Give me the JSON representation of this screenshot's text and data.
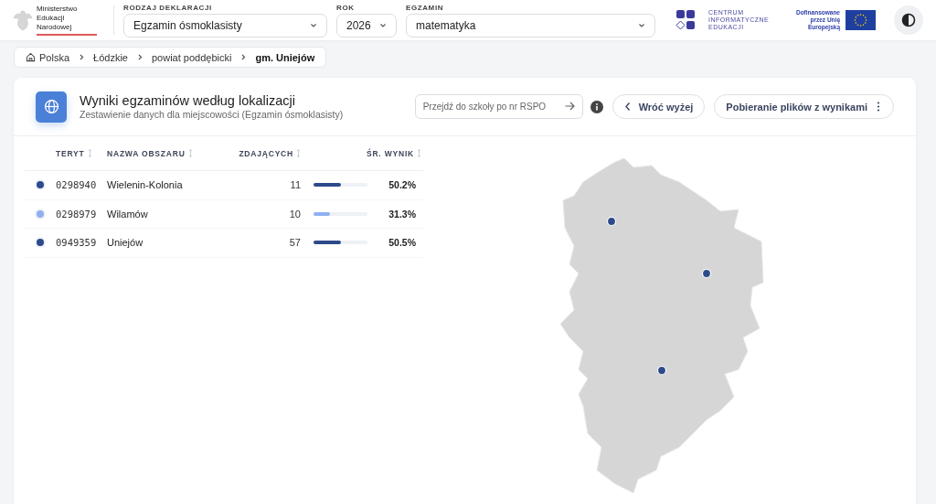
{
  "header": {
    "ministry_logo": "Ministerstwo Edukacji Narodowej",
    "filters": [
      {
        "label": "RODZAJ DEKLARACJI",
        "value": "Egzamin ósmoklasisty"
      },
      {
        "label": "ROK",
        "value": "2026"
      },
      {
        "label": "EGZAMIN",
        "value": "matematyka"
      }
    ],
    "cie_logo": "CENTRUM INFORMATYCZNE EDUKACJI",
    "eu_logo": "Dofinansowane przez Unię Europejską"
  },
  "breadcrumb": [
    {
      "label": "Polska",
      "current": false
    },
    {
      "label": "Łódzkie",
      "current": false
    },
    {
      "label": "powiat poddębicki",
      "current": false
    },
    {
      "label": "gm. Uniejów",
      "current": true
    }
  ],
  "card": {
    "title": "Wyniki egzaminów według lokalizacji",
    "subtitle": "Zestawienie danych dla miejscowości (Egzamin ósmoklasisty)",
    "rspo": {
      "placeholder": "Przejdź do szkoły po nr RSPO"
    },
    "buttons": [
      "Wróć wyżej",
      "Pobieranie plików z wynikami"
    ]
  },
  "table": {
    "columns": [
      "TERYT",
      "NAZWA OBSZARU",
      "ZDAJĄCYCH",
      "ŚR. WYNIK"
    ],
    "rows": [
      {
        "color": "#2d4a8a",
        "teryt": "0298940",
        "name": "Wielenin-Kolonia",
        "count": "11",
        "level": 0.502,
        "result": "50.2%"
      },
      {
        "color": "#8fb0f0",
        "teryt": "0298979",
        "name": "Wilamów",
        "count": "10",
        "level": 0.313,
        "result": "31.3%"
      },
      {
        "color": "#2d4a8a",
        "teryt": "0949359",
        "name": "Uniejów",
        "count": "57",
        "level": 0.505,
        "result": "50.5%"
      }
    ]
  },
  "map": {
    "kind": "region-map"
  }
}
